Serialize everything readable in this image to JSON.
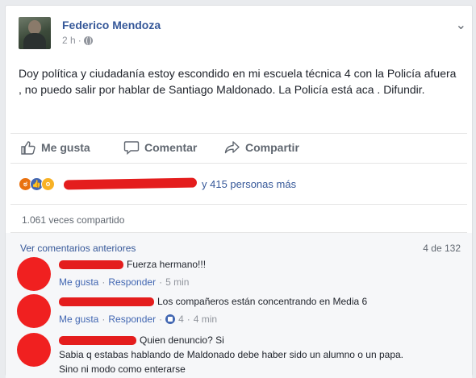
{
  "post": {
    "author": "Federico Mendoza",
    "time": "2 h",
    "separator": "·",
    "text": "Doy política y ciudadanía estoy escondido en mi escuela técnica 4 con la Policía afuera , no puedo salir por hablar de Santiago Maldonado. La Policía está aca . Difundir.",
    "more_icon": "more-icon",
    "privacy_icon": "globe-icon"
  },
  "actions": {
    "like": "Me gusta",
    "comment": "Comentar",
    "share": "Compartir"
  },
  "reactions": {
    "types": [
      "angry",
      "like",
      "wow"
    ],
    "others": "y 415 personas más"
  },
  "shares": {
    "label": "1.061 veces compartido"
  },
  "comments": {
    "view_previous": "Ver comentarios anteriores",
    "count": "4 de 132",
    "items": [
      {
        "text": "Fuerza hermano!!!",
        "like": "Me gusta",
        "sep1": "·",
        "reply": "Responder",
        "sep2": "·",
        "time": "5 min"
      },
      {
        "text": "Los compañeros están concentrando en Media 6",
        "like": "Me gusta",
        "sep1": "·",
        "reply": "Responder",
        "sep2": "·",
        "likes": "4",
        "sep3": "·",
        "time": "4 min"
      },
      {
        "text": "Quien denuncio? Si",
        "text_line2": "Sabia q estabas hablando de Maldonado debe haber sido un alumno o un papa.",
        "text_line3": "Sino ni modo como enterarse"
      }
    ]
  },
  "colors": {
    "link": "#365899",
    "accent": "#4267b2",
    "redaction": "#e41d1d",
    "muted": "#90949c"
  }
}
